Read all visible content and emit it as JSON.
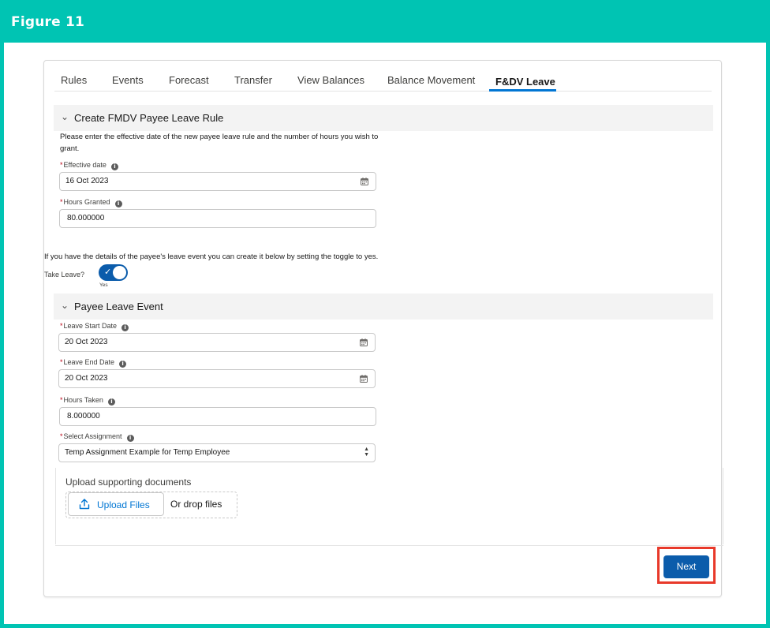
{
  "figure": {
    "title": "Figure 11"
  },
  "tabs": [
    {
      "label": "Rules"
    },
    {
      "label": "Events"
    },
    {
      "label": "Forecast"
    },
    {
      "label": "Transfer"
    },
    {
      "label": "View Balances"
    },
    {
      "label": "Balance Movement"
    },
    {
      "label": "F&DV Leave",
      "active": true
    }
  ],
  "rule_section": {
    "title": "Create FMDV Payee Leave Rule",
    "description": "Please enter the effective date of the new payee leave rule and the number of hours you wish to grant.",
    "effective_date": {
      "label": "Effective date",
      "value": "16 Oct 2023"
    },
    "hours_granted": {
      "label": "Hours Granted",
      "value": "80.000000"
    }
  },
  "leave_toggle": {
    "description": "If you have the details of the payee's leave event you can create it below by setting the toggle to yes.",
    "label": "Take Leave?",
    "state_text": "Yes",
    "checked": true
  },
  "event_section": {
    "title": "Payee Leave Event",
    "start_date": {
      "label": "Leave Start Date",
      "value": "20 Oct 2023"
    },
    "end_date": {
      "label": "Leave End Date",
      "value": "20 Oct 2023"
    },
    "hours_taken": {
      "label": "Hours Taken",
      "value": "8.000000"
    },
    "assignment": {
      "label": "Select Assignment",
      "value": "Temp Assignment Example for Temp Employee"
    }
  },
  "upload": {
    "title": "Upload supporting documents",
    "button_label": "Upload Files",
    "drop_text": "Or drop files"
  },
  "footer": {
    "next_label": "Next"
  },
  "icons": {
    "info": "info-icon",
    "calendar": "calendar-icon",
    "chevron": "chevron-down-icon",
    "upload": "upload-icon",
    "check": "check-icon"
  },
  "colors": {
    "frame": "#00c4b3",
    "brand_blue": "#0b5cab",
    "link_blue": "#0176d3",
    "highlight": "#e8392a",
    "required": "#ba0517"
  }
}
